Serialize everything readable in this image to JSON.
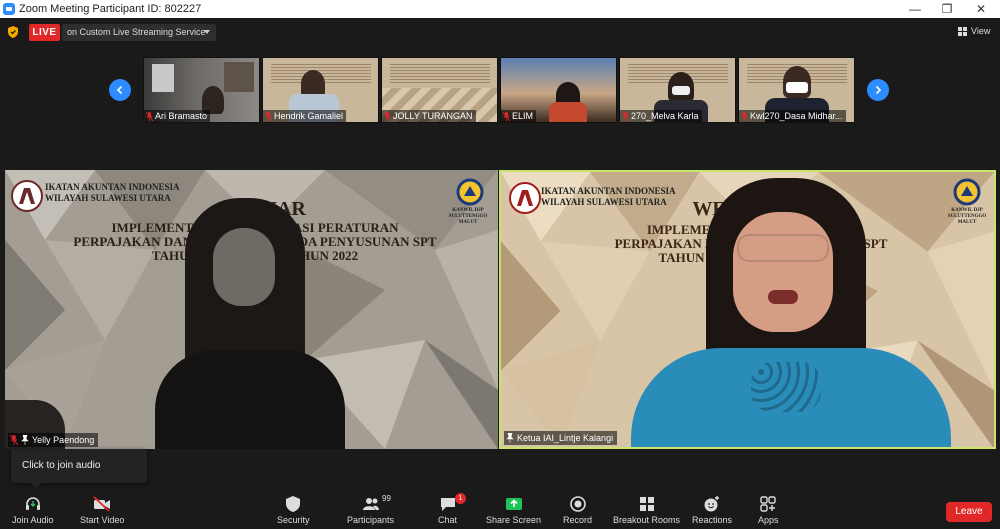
{
  "window": {
    "title": "Zoom Meeting Participant ID: 802227"
  },
  "header": {
    "live_label": "LIVE",
    "stream_label": "on Custom Live Streaming Service",
    "view_label": "View"
  },
  "thumbnails": [
    {
      "name": "Ari Bramasto"
    },
    {
      "name": "Hendrik Gamaliel"
    },
    {
      "name": "JOLLY TURANGAN"
    },
    {
      "name": "ELIM"
    },
    {
      "name": "270_Melva Karla"
    },
    {
      "name": "Kwl270_Dasa Midhar..."
    }
  ],
  "slide": {
    "org_line1": "IKATAN AKUNTAN INDONESIA",
    "org_line2": "WILAYAH SULAWESI UTARA",
    "left": {
      "org_line1": "IKATAN AKUNTAN INDONESIA",
      "org_line2": "WILAYAH SULAWESI UTARA",
      "webinar": "WE      NAR",
      "line1": "IMPLEMENTASI UU HAR    NISASI PERATURAN",
      "line2": "PERPAJAKAN DAN DAMPAKNYA PADA PENYUSUNAN SPT",
      "line3": "TAHUN 2021 DAN         AN TAHUN 2022",
      "kanwil": "KANWIL DJP SULUTTENGGO MALUT"
    },
    "right": {
      "org_line1": "IKATAN AKUNTAN INDONESIA",
      "org_line2": "WILAYAH SULAWESI UTARA",
      "webinar": "WE",
      "line1": "IMPLEMENTASI UU           PERATURAN",
      "line2": "PERPAJAKAN DAN DAM           PENYUSUNAN SPT",
      "line3": "TAHUN 2021 DAN            TAHUN 2022",
      "kanwil": "KANWIL DJP SULUTTENGGO MALUT"
    }
  },
  "videos": {
    "left_name": "Yelly Paendong",
    "right_name": "Ketua IAI_Lintje Kalangi"
  },
  "toast": {
    "text": "Click to join audio"
  },
  "toolbar": {
    "join_audio": "Join Audio",
    "start_video": "Start Video",
    "security": "Security",
    "participants": "Participants",
    "participants_count": "99",
    "chat": "Chat",
    "chat_badge": "1",
    "share_screen": "Share Screen",
    "record": "Record",
    "breakout_rooms": "Breakout Rooms",
    "reactions": "Reactions",
    "apps": "Apps",
    "leave": "Leave"
  },
  "colors": {
    "accent": "#2d8cff",
    "live_red": "#e02828",
    "active_speaker": "#c8e46a",
    "share_green": "#1fc35b"
  }
}
